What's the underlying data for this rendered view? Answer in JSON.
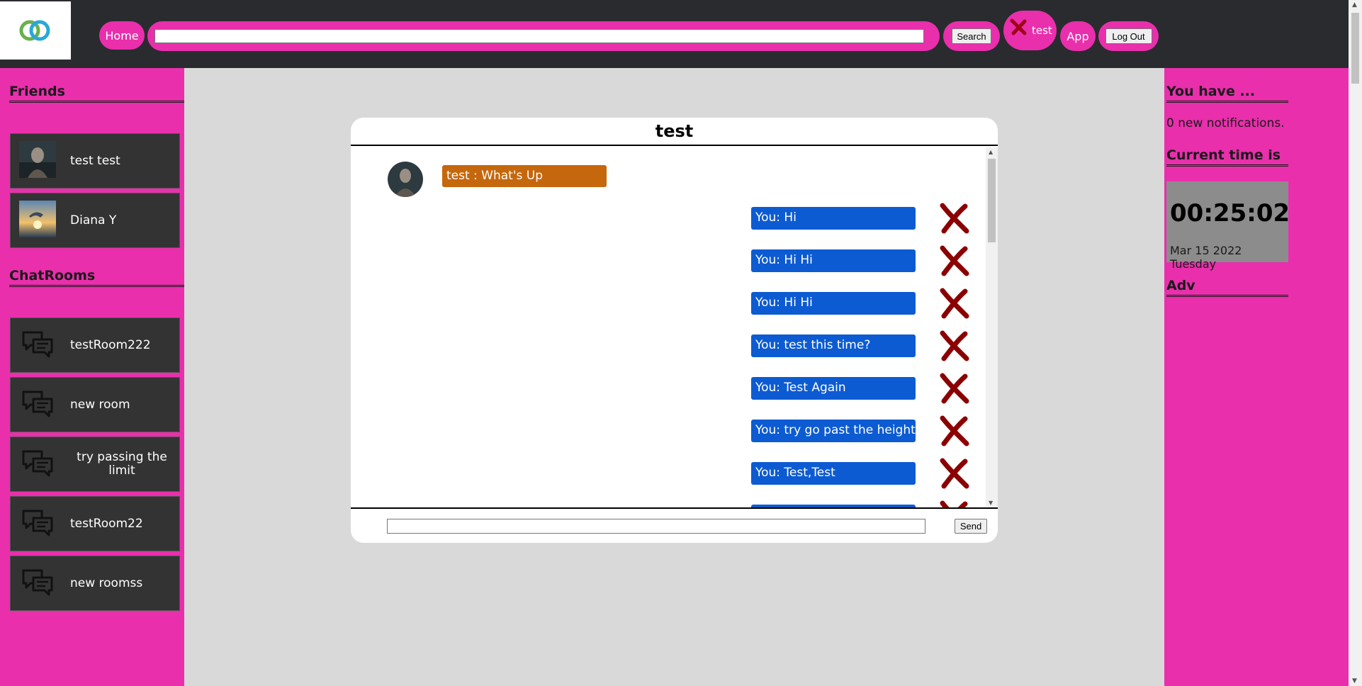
{
  "topbar": {
    "home_label": "Home",
    "search_value": "",
    "search_label": "Search",
    "user_label": "test",
    "app_label": "App",
    "logout_label": "Log Out"
  },
  "left": {
    "friends_title": "Friends",
    "friends": [
      {
        "name": "test test"
      },
      {
        "name": "Diana Y"
      }
    ],
    "rooms_title": "ChatRooms",
    "rooms": [
      {
        "name": "testRoom222"
      },
      {
        "name": "new room"
      },
      {
        "name": "try passing the limit"
      },
      {
        "name": "testRoom22"
      },
      {
        "name": "new roomss"
      }
    ]
  },
  "right": {
    "notifications_title": "You have ...",
    "notifications_text": "0 new notifications.",
    "time_title": "Current time is",
    "time": "00:25:02",
    "date": "Mar 15 2022",
    "weekday": "Tuesday",
    "adv_title": "Adv"
  },
  "chat": {
    "title": "test",
    "incoming": "test : What's Up",
    "outgoing": [
      "You: Hi",
      "You: Hi Hi",
      "You: Hi Hi",
      "You: test this time?",
      "You: Test Again",
      "You: try go past the height",
      "You: Test,Test"
    ],
    "input_value": "",
    "send_label": "Send"
  },
  "colors": {
    "accent": "#e92fac",
    "topbar": "#2a2b2f",
    "incoming_bubble": "#c5670c",
    "outgoing_bubble": "#0c5bd2",
    "delete_x": "#8b0000"
  }
}
